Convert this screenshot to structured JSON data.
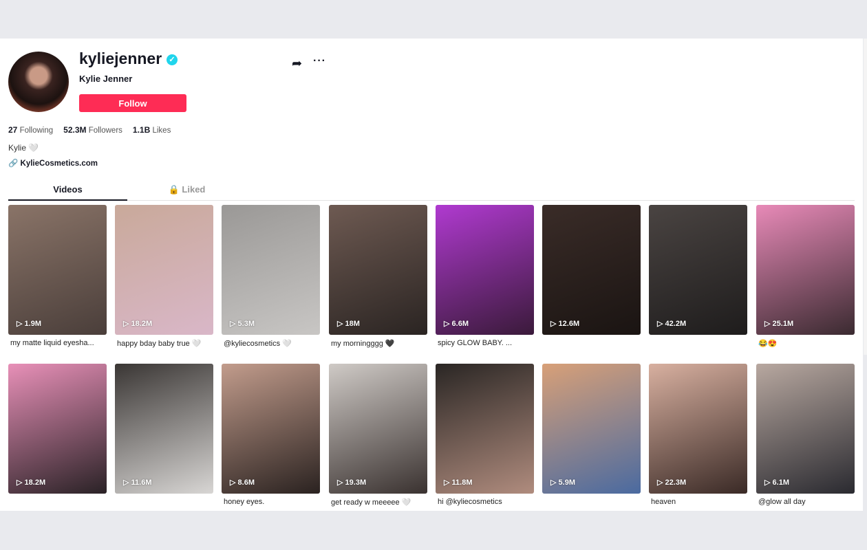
{
  "profile": {
    "username": "kyliejenner",
    "display_name": "Kylie Jenner",
    "follow_label": "Follow",
    "following": "27",
    "following_label": "Following",
    "followers": "52.3M",
    "followers_label": "Followers",
    "likes": "1.1B",
    "likes_label": "Likes",
    "bio": "Kylie 🤍",
    "link": "KylieCosmetics.com"
  },
  "tabs": [
    {
      "label": "Videos",
      "active": true
    },
    {
      "label": "Liked",
      "locked": true
    }
  ],
  "colors": {
    "accent": "#fe2c55",
    "verified": "#20d5ec"
  },
  "videos": [
    {
      "views": "1.9M",
      "caption": "my matte liquid eyesha...",
      "thumb": [
        "#8a7468",
        "#4a3e3a"
      ]
    },
    {
      "views": "18.2M",
      "caption": "happy bday baby true 🤍",
      "thumb": [
        "#c9a99a",
        "#d9b7c8"
      ]
    },
    {
      "views": "5.3M",
      "caption": "@kyliecosmetics 🤍",
      "thumb": [
        "#9a9896",
        "#c8c6c4"
      ]
    },
    {
      "views": "18M",
      "caption": "my morningggg 🖤",
      "thumb": [
        "#6e5a52",
        "#2a2422"
      ]
    },
    {
      "views": "6.6M",
      "caption": "spicy GLOW BABY. ...",
      "thumb": [
        "#b03ad0",
        "#3a1a3a"
      ]
    },
    {
      "views": "12.6M",
      "caption": "",
      "thumb": [
        "#3a2c28",
        "#1a1412"
      ]
    },
    {
      "views": "42.2M",
      "caption": "",
      "thumb": [
        "#4a4442",
        "#1e1c1c"
      ]
    },
    {
      "views": "25.1M",
      "caption": "😂😍",
      "thumb": [
        "#e88ab8",
        "#3a2a30"
      ]
    },
    {
      "views": "18.2M",
      "caption": "",
      "thumb": [
        "#e890b8",
        "#2a2226"
      ]
    },
    {
      "views": "11.6M",
      "caption": "",
      "thumb": [
        "#3a3634",
        "#d8d6d4"
      ]
    },
    {
      "views": "8.6M",
      "caption": "honey eyes.",
      "thumb": [
        "#c29c8c",
        "#2a2220"
      ]
    },
    {
      "views": "19.3M",
      "caption": "get ready w meeeee 🤍",
      "thumb": [
        "#cfcac6",
        "#3a3230"
      ]
    },
    {
      "views": "11.8M",
      "caption": "hi @kyliecosmetics",
      "thumb": [
        "#2a2624",
        "#b08c7e"
      ]
    },
    {
      "views": "5.9M",
      "caption": "",
      "thumb": [
        "#d8a078",
        "#4a6aa0"
      ]
    },
    {
      "views": "22.3M",
      "caption": "heaven",
      "thumb": [
        "#d8b0a0",
        "#3a2a26"
      ]
    },
    {
      "views": "6.1M",
      "caption": "@glow all day",
      "thumb": [
        "#b8a8a0",
        "#2a2a30"
      ]
    }
  ]
}
